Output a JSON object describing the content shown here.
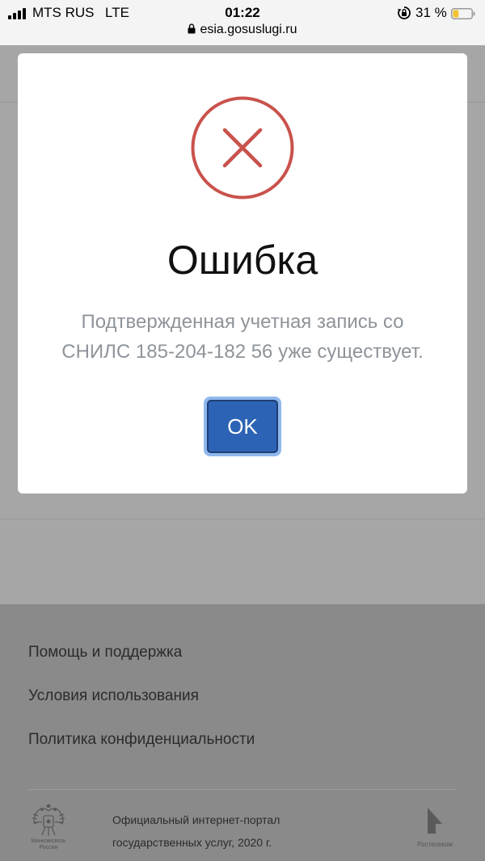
{
  "status_bar": {
    "carrier": "MTS RUS",
    "network": "LTE",
    "time": "01:22",
    "battery_percent": "31 %",
    "battery_level": 0.31,
    "url": "esia.gosuslugi.ru"
  },
  "dialog": {
    "title": "Ошибка",
    "message_line1": "Подтвержденная учетная запись со",
    "message_line2": "СНИЛС 185-204-182 56 уже существует.",
    "ok_label": "OK",
    "error_color": "#c9524c",
    "button_color": "#2c63b5"
  },
  "footer": {
    "links": [
      "Помощь и поддержка",
      "Условия использования",
      "Политика конфиденциальности"
    ],
    "emblem_caption_line1": "Минкомсвязь",
    "emblem_caption_line2": "России",
    "portal_line1": "Официальный интернет-портал",
    "portal_line2": "государственных услуг, 2020 г.",
    "partner_caption": "Ростелеком"
  }
}
